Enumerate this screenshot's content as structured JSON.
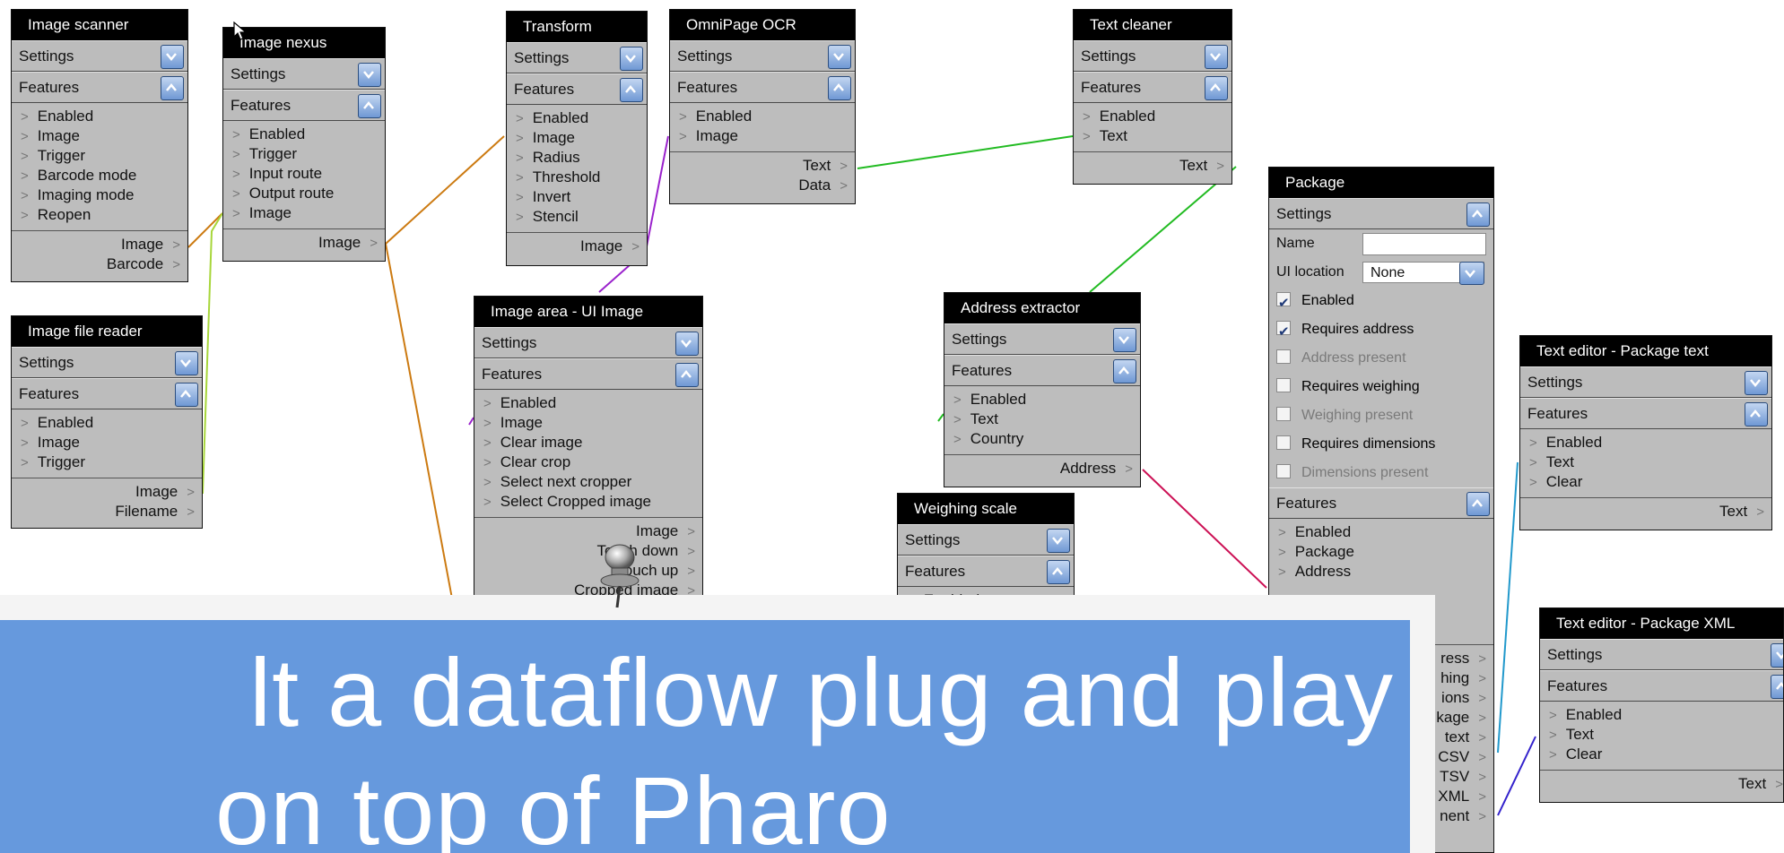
{
  "colors": {
    "node_bg": "#bdbdbd",
    "title_bg": "#000000",
    "banner_bg": "#6699dd",
    "wire_orange": "#cc7a11",
    "wire_lime": "#a7d63a",
    "wire_purple": "#9a22cc",
    "wire_green": "#22bb22",
    "wire_magenta": "#cc1155",
    "wire_cyan": "#2299cc",
    "wire_blue": "#3322cc"
  },
  "icons": {
    "section_toggle": "chevron-icon",
    "input_arrow": "gt-icon",
    "output_arrow": "gt-icon",
    "cursor": "arrow-cursor-icon",
    "pin": "pushpin-icon"
  },
  "common": {
    "settings": "Settings",
    "features": "Features",
    "gt": ">"
  },
  "nodes": {
    "image_scanner": {
      "title": "Image scanner",
      "inputs": [
        "Enabled",
        "Image",
        "Trigger",
        "Barcode mode",
        "Imaging mode",
        "Reopen"
      ],
      "outputs": [
        "Image",
        "Barcode"
      ]
    },
    "image_nexus": {
      "title": "Image nexus",
      "inputs": [
        "Enabled",
        "Trigger",
        "Input route",
        "Output route",
        "Image"
      ],
      "outputs": [
        "Image"
      ]
    },
    "image_file_reader": {
      "title": "Image file reader",
      "inputs": [
        "Enabled",
        "Image",
        "Trigger"
      ],
      "outputs": [
        "Image",
        "Filename"
      ]
    },
    "transform": {
      "title": "Transform",
      "inputs": [
        "Enabled",
        "Image",
        "Radius",
        "Threshold",
        "Invert",
        "Stencil"
      ],
      "outputs": [
        "Image"
      ]
    },
    "omnipage_ocr": {
      "title": "OmniPage OCR",
      "inputs": [
        "Enabled",
        "Image"
      ],
      "outputs": [
        "Text",
        "Data"
      ]
    },
    "image_area": {
      "title": "Image area - UI Image",
      "inputs": [
        "Enabled",
        "Image",
        "Clear image",
        "Clear crop",
        "Select next cropper",
        "Select Cropped image"
      ],
      "outputs": [
        "Image",
        "Touch down",
        "Touch up",
        "Cropped image"
      ]
    },
    "text_cleaner": {
      "title": "Text cleaner",
      "inputs": [
        "Enabled",
        "Text"
      ],
      "outputs": [
        "Text"
      ]
    },
    "address_extractor": {
      "title": "Address extractor",
      "inputs": [
        "Enabled",
        "Text",
        "Country"
      ],
      "outputs": [
        "Address"
      ]
    },
    "weighing_scale": {
      "title": "Weighing scale",
      "inputs": [
        "Enabled"
      ],
      "outputs": []
    },
    "package": {
      "title": "Package",
      "name_label": "Name",
      "name_value": "",
      "ui_location_label": "UI location",
      "ui_location_value": "None",
      "checks": [
        {
          "label": "Enabled",
          "checked": true,
          "dim": false
        },
        {
          "label": "Requires address",
          "checked": true,
          "dim": false
        },
        {
          "label": "Address present",
          "checked": false,
          "dim": true
        },
        {
          "label": "Requires weighing",
          "checked": false,
          "dim": false
        },
        {
          "label": "Weighing present",
          "checked": false,
          "dim": true
        },
        {
          "label": "Requires dimensions",
          "checked": false,
          "dim": false
        },
        {
          "label": "Dimensions present",
          "checked": false,
          "dim": true
        }
      ],
      "inputs": [
        "Enabled",
        "Package",
        "Address"
      ],
      "outputs": [
        "ress",
        "hing",
        "ions",
        "kage",
        "text",
        "CSV",
        "TSV",
        "XML",
        "nent"
      ]
    },
    "text_editor_package_text": {
      "title": "Text editor - Package text",
      "inputs": [
        "Enabled",
        "Text",
        "Clear"
      ],
      "outputs": [
        "Text"
      ]
    },
    "text_editor_package_xml": {
      "title": "Text editor - Package XML",
      "inputs": [
        "Enabled",
        "Text",
        "Clear"
      ],
      "outputs": [
        "Text"
      ]
    }
  },
  "banner": {
    "line1": "lt a dataflow plug and play",
    "line2": "on top of Pharo"
  }
}
